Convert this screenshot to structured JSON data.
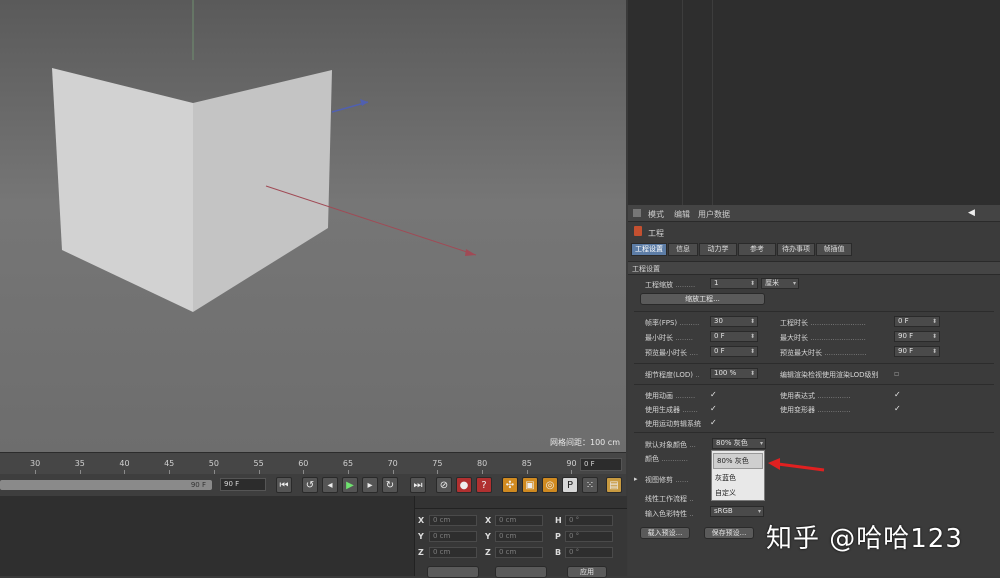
{
  "viewport": {
    "grid_spacing": "网格间距：100 cm"
  },
  "timeline": {
    "ticks": [
      "30",
      "35",
      "40",
      "45",
      "50",
      "55",
      "60",
      "65",
      "70",
      "75",
      "80",
      "85",
      "90"
    ],
    "current_frame": "0 F"
  },
  "transport": {
    "end_frame_a": "90 F",
    "end_frame_b": "90 F"
  },
  "coords": {
    "rows": [
      {
        "a": "X",
        "av": "0 cm",
        "b": "X",
        "bv": "0 cm",
        "c": "H",
        "cv": "0 °"
      },
      {
        "a": "Y",
        "av": "0 cm",
        "b": "Y",
        "bv": "0 cm",
        "c": "P",
        "cv": "0 °"
      },
      {
        "a": "Z",
        "av": "0 cm",
        "b": "Z",
        "bv": "0 cm",
        "c": "B",
        "cv": "0 °"
      }
    ],
    "apply": "应用"
  },
  "attributes": {
    "menu": [
      "模式",
      "编辑",
      "用户数据"
    ],
    "header": "工程",
    "tabs": [
      "工程设置",
      "信息",
      "动力学",
      "参考",
      "待办事项",
      "帧插值"
    ],
    "section": "工程设置",
    "scale_label": "工程缩放",
    "scale_value": "1",
    "scale_unit": "厘米",
    "scale_button": "缩放工程...",
    "fps_label": "帧率(FPS)",
    "fps_value": "30",
    "project_length_label": "工程时长",
    "project_length_value": "0 F",
    "min_time_label": "最小时长",
    "min_time_value": "0 F",
    "max_time_label": "最大时长",
    "max_time_value": "90 F",
    "preview_min_label": "预览最小时长",
    "preview_min_value": "0 F",
    "preview_max_label": "预览最大时长",
    "preview_max_value": "90 F",
    "lod_label": "细节程度(LOD)",
    "lod_value": "100 %",
    "lod_render_label": "编辑渲染检视使用渲染LOD级别",
    "use_anim_label": "使用动画",
    "use_expr_label": "使用表达式",
    "use_gen_label": "使用生成器",
    "use_deform_label": "使用变形器",
    "use_motion_label": "使用运动剪辑系统",
    "default_color_label": "默认对象颜色",
    "default_color_value": "80% 灰色",
    "color_label": "颜色",
    "view_clip_label": "视图修剪",
    "linear_workflow_label": "线性工作流程",
    "input_color_label": "输入色彩特性",
    "input_color_value": "sRGB",
    "load_preset": "载入预设...",
    "save_preset": "保存预设...",
    "dropdown_options": [
      "80% 灰色",
      "灰蓝色",
      "自定义"
    ]
  },
  "watermark": "知乎 @哈哈123"
}
